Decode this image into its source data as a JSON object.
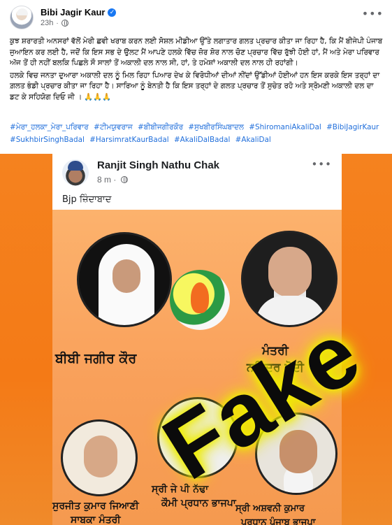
{
  "post": {
    "author": "Bibi Jagir Kaur",
    "time": "23h",
    "verified": true,
    "paragraph1": "ਕੁਝ ਸ਼ਰਾਰਤੀ ਅਨਸਰਾਂ ਵੱਲੋਂ ਮੇਰੀ ਛਵੀ ਖਰਾਬ ਕਰਨ ਲਈ ਸੋਸ਼ਲ ਮੀਡੀਆ ਉੱਤੇ ਲਗਾਤਾਰ ਗਲਤ ਪ੍ਰਚਾਰ ਕੀਤਾ ਜਾ ਰਿਹਾ ਹੈ, ਕਿ ਮੈਂ ਬੀਜੇਪੀ ਪੰਜਾਬ ਜੁਆਇਨ ਕਰ ਲਈ ਹੈ, ਜਦੋਂ ਕਿ ਇਸ ਸਭ ਦੇ ਉਲਟ ਮੈਂ ਆਪਣੇ ਹਲਕੇ ਵਿੱਚ ਜ਼ੋਰ ਸ਼ੋਰ ਨਾਲ ਚੋਣ ਪ੍ਰਚਾਰ ਵਿੱਚ ਰੁੱਝੀ ਹੋਈ ਹਾਂ, ਮੈਂ ਅਤੇ ਮੇਰਾ ਪਰਿਵਾਰ ਅੱਜ ਤੋਂ ਹੀ ਨਹੀਂ ਬਲਕਿ ਪਿਛਲੇ ਸੌ ਸਾਲਾਂ ਤੋਂ ਅਕਾਲੀ ਦਲ ਨਾਲ ਸੀ, ਹਾਂ, ਤੇ ਹਮੇਸ਼ਾਂ ਅਕਾਲੀ ਦਲ ਨਾਲ ਹੀ ਰਹਾਂਗੀ।",
    "paragraph2": "ਹਲਕੇ ਵਿਚ ਜਨਤਾ ਦੁਆਰਾ ਅਕਾਲੀ ਦਲ ਨੂੰ ਮਿਲ ਰਿਹਾ ਪਿਆਰ ਦੇਖ ਕੇ ਵਿਰੋਧੀਆਂ ਦੀਆਂ ਨੀਂਦਾਂ ਉੱਡੀਆਂ ਹੋਈਆਂ ਹਨ ਇਸ ਕਰਕੇ ਇਸ ਤਰ੍ਹਾਂ ਦਾ ਗ਼ਲਤ ਭੰਡੀ ਪ੍ਰਚਾਰ ਕੀਤਾ ਜਾ ਰਿਹਾ ਹੈ। ਸਾਰਿਆ ਨੂੰ ਬੇਨਤੀ ਹੈ ਕਿ ਇਸ ਤਰ੍ਹਾਂ ਦੇ ਗਲਤ ਪ੍ਰਚਾਰ ਤੋਂ ਸੁਚੇਤ ਰਹੋ ਅਤੇ ਸ੍ਰੋਮਣੀ ਅਕਾਲੀ ਦਲ ਦਾ ਡਟ ਕੇ ਸਹਿਯੋਗ ਦਿਓ ਜੀ । 🙏🙏🙏",
    "hashtags": [
      "#ਮੇਰਾ_ਹਲਕਾ_ਮੇਰਾ_ਪਰਿਵਾਰ",
      "#ਟੀਮਯੁਵਰਾਜ",
      "#ਬੀਬੀਜਗੀਰਕੌਰ",
      "#ਸੁਖਬੀਰਸਿੰਘਬਾਦਲ",
      "#ShiromaniAkaliDal",
      "#BibiJagirKaur",
      "#SukhbirSinghBadal",
      "#HarsimratKaurBadal",
      "#AkaliDalBadal",
      "#AkaliDal"
    ]
  },
  "image": {
    "screenshot_author": "Ranjit Singh Nathu Chak",
    "screenshot_time": "8 m ·",
    "screenshot_caption": "Bjp ਜ਼ਿੰਦਾਬਾਦ",
    "watermark": "Fake",
    "labels": {
      "bibi": "ਬੀਬੀ ਜਗੀਰ ਕੌਰ",
      "modi_line1": "ਮੰਤਰੀ",
      "modi_line2": "ਨਰਿੰਦਰ ਮੋਦੀ",
      "w1_line1": "ਸੁਰਜੀਤ ਕੁਮਾਰ ਜਿਆਣੀ",
      "w1_line2": "ਸਾਬਕਾ ਮੰਤਰੀ",
      "w2_line1": "ਸ੍ਰੀ ਜੇ ਪੀ ਨੱਢਾ",
      "w2_line2": "ਕੌਮੀ ਪ੍ਰਧਾਨ ਭਾਜਪਾ",
      "w3_line1": "ਸ੍ਰੀ ਅਸ਼ਵਨੀ ਕੁਮਾਰ",
      "w3_line2": "ਪ੍ਰਧਾਨ ਪੰਜਾਬ ਭਾਜਪਾ"
    }
  },
  "colors": {
    "hashtag": "#216fdb",
    "verified": "#1877f2",
    "poster_bg": "#f7a35c",
    "watermark_glow": "#f0f000"
  }
}
